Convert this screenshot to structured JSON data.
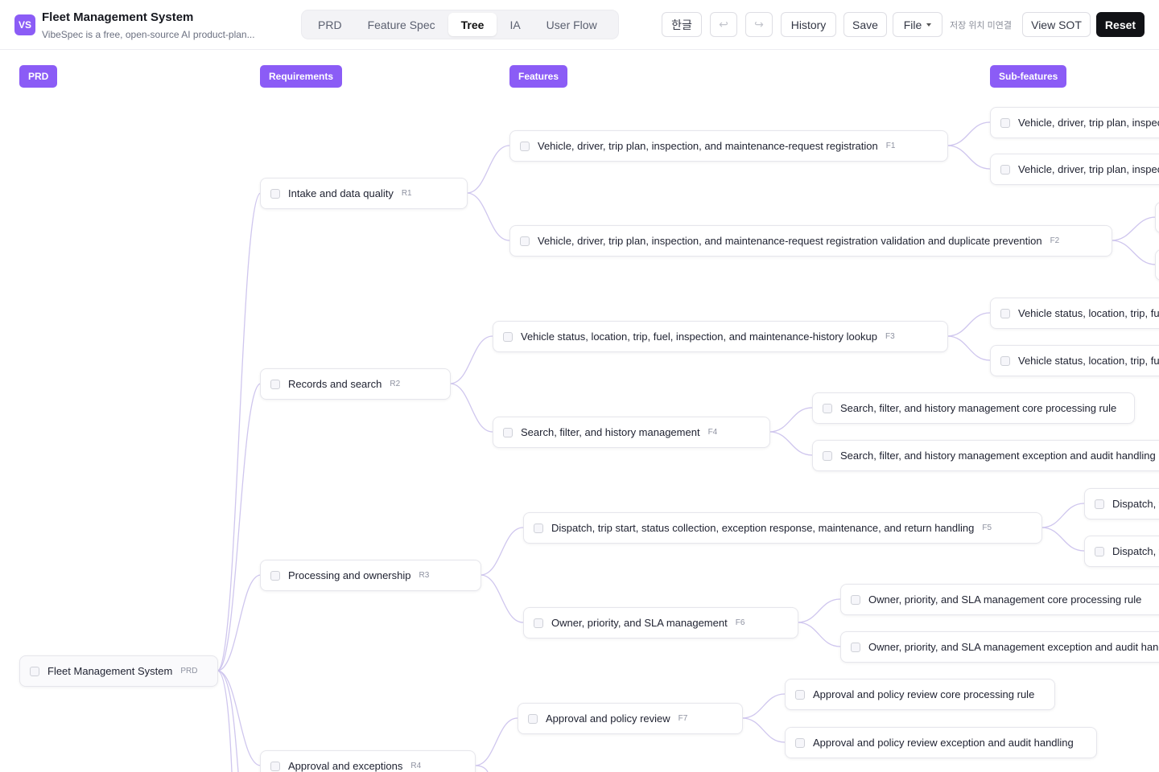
{
  "header": {
    "logo": "VS",
    "title": "Fleet Management System",
    "subtitle": "VibeSpec is a free, open-source AI product-plan...",
    "tabs": [
      "PRD",
      "Feature Spec",
      "Tree",
      "IA",
      "User Flow"
    ],
    "active_tab": "Tree",
    "language_label": "한글",
    "undo_icon": "↩",
    "redo_icon": "↪",
    "history_label": "History",
    "save_label": "Save",
    "file_label": "File",
    "save_status": "저장 위치 미연결",
    "view_sot_label": "View SOT",
    "reset_label": "Reset"
  },
  "columns": {
    "prd": "PRD",
    "requirements": "Requirements",
    "features": "Features",
    "subfeatures": "Sub-features"
  },
  "nodes": {
    "root": {
      "text": "Fleet Management System",
      "id": "PRD"
    },
    "r1": {
      "text": "Intake and data quality",
      "id": "R1"
    },
    "r2": {
      "text": "Records and search",
      "id": "R2"
    },
    "r3": {
      "text": "Processing and ownership",
      "id": "R3"
    },
    "r4": {
      "text": "Approval and exceptions",
      "id": "R4"
    },
    "f1": {
      "text": "Vehicle, driver, trip plan, inspection, and maintenance-request registration",
      "id": "F1"
    },
    "f2": {
      "text": "Vehicle, driver, trip plan, inspection, and maintenance-request registration validation and duplicate prevention",
      "id": "F2"
    },
    "f3": {
      "text": "Vehicle status, location, trip, fuel, inspection, and maintenance-history lookup",
      "id": "F3"
    },
    "f4": {
      "text": "Search, filter, and history management",
      "id": "F4"
    },
    "f5": {
      "text": "Dispatch, trip start, status collection, exception response, maintenance, and return handling",
      "id": "F5"
    },
    "f6": {
      "text": "Owner, priority, and SLA management",
      "id": "F6"
    },
    "f7": {
      "text": "Approval and policy review",
      "id": "F7"
    },
    "s1a": {
      "text": "Vehicle, driver, trip plan, inspec"
    },
    "s1b": {
      "text": "Vehicle, driver, trip plan, inspec"
    },
    "s3a": {
      "text": "Vehicle status, location, trip, fue"
    },
    "s3b": {
      "text": "Vehicle status, location, trip, fue"
    },
    "s4a": {
      "text": "Search, filter, and history management core processing rule"
    },
    "s4b": {
      "text": "Search, filter, and history management exception and audit handling"
    },
    "s5a": {
      "text": "Dispatch, t"
    },
    "s5b": {
      "text": "Dispatch, t"
    },
    "s6a": {
      "text": "Owner, priority, and SLA management core processing rule"
    },
    "s6b": {
      "text": "Owner, priority, and SLA management exception and audit hand"
    },
    "s7a": {
      "text": "Approval and policy review core processing rule"
    },
    "s7b": {
      "text": "Approval and policy review exception and audit handling"
    }
  }
}
